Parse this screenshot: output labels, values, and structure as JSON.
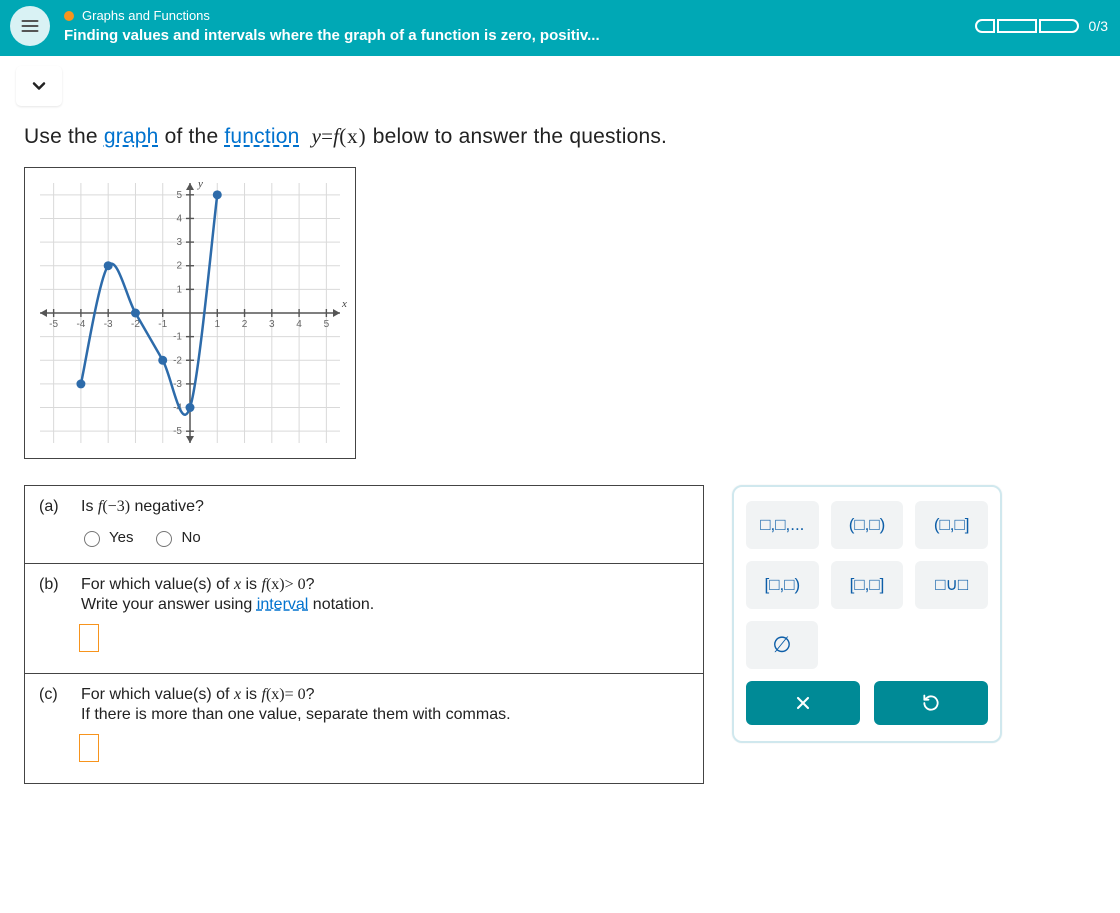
{
  "header": {
    "topic": "Graphs and Functions",
    "task": "Finding values and intervals where the graph of a function is zero, positiv...",
    "progress_label": "0/3"
  },
  "prompt": {
    "pre1": "Use the ",
    "link1": "graph",
    "mid1": " of the ",
    "link2": "function",
    "post": " below to answer the questions.",
    "equation_lhs": "y",
    "equation_eq": "=",
    "equation_rhs_f": "f",
    "equation_rhs_paren": "(x)"
  },
  "chart_data": {
    "type": "line",
    "xlabel": "x",
    "ylabel": "y",
    "xlim": [
      -5.5,
      5.5
    ],
    "ylim": [
      -5.5,
      5.5
    ],
    "series": [
      {
        "name": "f(x)",
        "points": [
          [
            -4,
            -3
          ],
          [
            -3,
            2
          ],
          [
            -2,
            0
          ],
          [
            -1,
            -2
          ],
          [
            0,
            -4
          ],
          [
            1,
            5
          ]
        ]
      }
    ],
    "endpoints": {
      "left_closed": true,
      "right_closed": true
    }
  },
  "questions": {
    "a": {
      "label": "(a)",
      "text_pre": "Is ",
      "math_f": "f",
      "math_arg": "(−3)",
      "text_post": " negative?",
      "yes": "Yes",
      "no": "No"
    },
    "b": {
      "label": "(b)",
      "line1_pre": "For which value(s) of ",
      "x": "x",
      "line1_mid": " is ",
      "math_f": "f",
      "math_arg": "(x)",
      "op": "> 0",
      "q": "?",
      "line2_pre": "Write your answer using ",
      "link": "interval",
      "line2_post": " notation."
    },
    "c": {
      "label": "(c)",
      "line1_pre": "For which value(s) of ",
      "x": "x",
      "line1_mid": " is ",
      "math_f": "f",
      "math_arg": "(x)",
      "op": "= 0",
      "q": "?",
      "line2": "If there is more than one value, separate them with commas."
    }
  },
  "palette": {
    "list": "□,□,...",
    "open_open": "(□,□)",
    "open_closed": "(□,□]",
    "closed_open": "[□,□)",
    "closed_closed": "[□,□]",
    "union": "□∪□",
    "empty": "∅",
    "clear": "×"
  }
}
